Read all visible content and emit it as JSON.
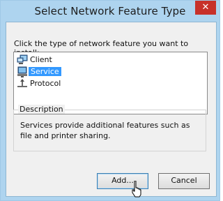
{
  "window": {
    "title": "Select Network Feature Type",
    "close_glyph": "✕"
  },
  "prompt": "Click the type of network feature you want to install:",
  "features": [
    {
      "label": "Client",
      "icon": "client-icon",
      "selected": false
    },
    {
      "label": "Service",
      "icon": "service-icon",
      "selected": true
    },
    {
      "label": "Protocol",
      "icon": "protocol-icon",
      "selected": false
    }
  ],
  "description": {
    "label": "Description",
    "text": "Services provide additional features such as file and printer sharing."
  },
  "buttons": {
    "add": "Add...",
    "cancel": "Cancel"
  },
  "colors": {
    "frame": "#aed4ef",
    "close": "#c7312a",
    "selection": "#3399ff"
  }
}
